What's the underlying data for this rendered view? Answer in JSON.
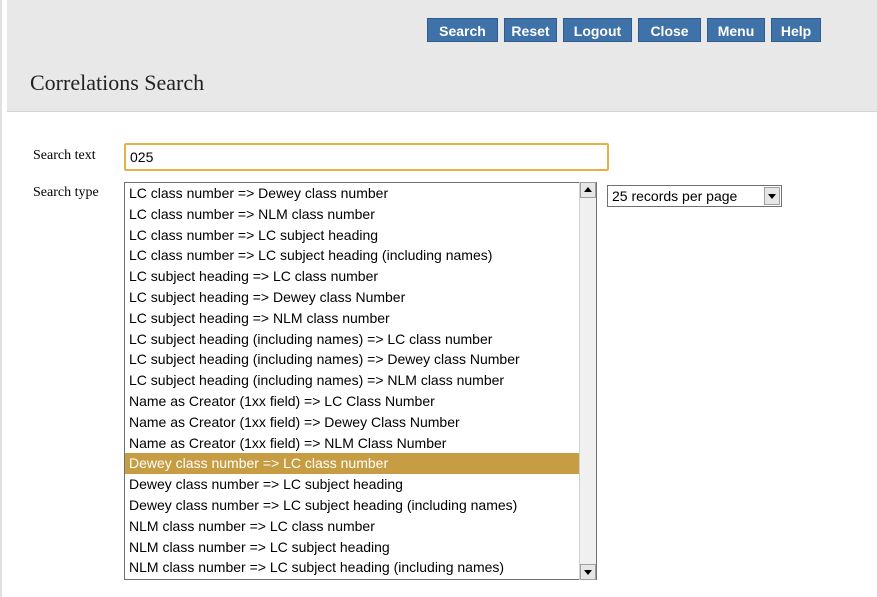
{
  "toolbar": {
    "search_label": "Search",
    "reset_label": "Reset",
    "logout_label": "Logout",
    "close_label": "Close",
    "menu_label": "Menu",
    "help_label": "Help"
  },
  "page": {
    "title": "Correlations Search"
  },
  "form": {
    "search_text_label": "Search text",
    "search_text_value": "025",
    "search_type_label": "Search type",
    "search_type_options": [
      "LC class number => Dewey class number",
      "LC class number => NLM class number",
      "LC class number => LC subject heading",
      "LC class number => LC subject heading (including names)",
      "LC subject heading => LC class number",
      "LC subject heading => Dewey class Number",
      "LC subject heading => NLM class number",
      "LC subject heading (including names) => LC class number",
      "LC subject heading (including names) => Dewey class Number",
      "LC subject heading (including names) => NLM class number",
      "Name as Creator (1xx field) => LC Class Number",
      "Name as Creator (1xx field) => Dewey Class Number",
      "Name as Creator (1xx field) => NLM Class Number",
      "Dewey class number => LC class number",
      "Dewey class number => LC subject heading",
      "Dewey class number => LC subject heading (including names)",
      "NLM class number => LC class number",
      "NLM class number => LC subject heading",
      "NLM class number => LC subject heading (including names)"
    ],
    "search_type_selected": "Dewey class number => LC class number",
    "records_per_page": "25 records per page"
  },
  "colors": {
    "toolbar_button": "#3e72a8",
    "header_background": "#e8e8e8",
    "selected_option": "#c79d43",
    "input_focus_border": "#e8b04a"
  },
  "icons": {
    "scroll_up": "triangle-up-icon",
    "scroll_down": "triangle-down-icon",
    "dropdown": "chevron-down-icon"
  }
}
